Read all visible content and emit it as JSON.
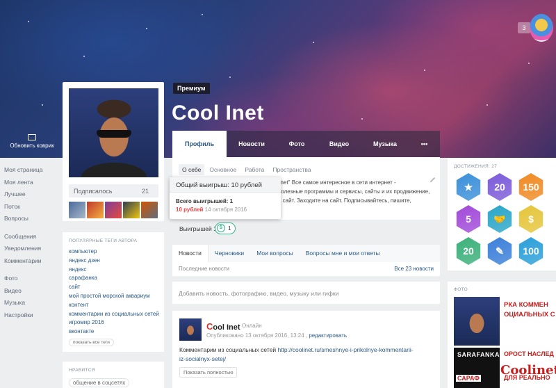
{
  "cover": {
    "update_label": "Обновить коврик",
    "badge_count": "3"
  },
  "left_nav": {
    "group1": [
      "Моя страница",
      "Моя лента",
      "Лучшее",
      "Поток",
      "Вопросы"
    ],
    "group2": [
      "Сообщения",
      "Уведомления",
      "Комментарии"
    ],
    "group3": [
      "Фото",
      "Видео",
      "Музыка",
      "Настройки"
    ]
  },
  "profile": {
    "premium_label": "Премиум",
    "username": "Cool Inet",
    "subscribed_label": "Подписалось",
    "subscribed_count": "21"
  },
  "tabs": [
    "Профиль",
    "Новости",
    "Фото",
    "Видео",
    "Музыка",
    "•••"
  ],
  "about": {
    "subtabs": [
      "О себе",
      "Основное",
      "Работа",
      "Пространства"
    ],
    "text_line1": "linet\" Все самое интересное в сети интернет -",
    "text_line2": "полезные программы и сервисы, сайты и их продвижение,",
    "text_line3": "а сайт. Заходите на сайт. Подписывайтесь, пишите,"
  },
  "wins": {
    "label": "Выигрышей 1:",
    "coin_symbol": "$",
    "count": "1"
  },
  "tooltip": {
    "title": "Общий выигрыш: 10 рублей",
    "total": "Всего выигрышей: 1",
    "amount": "10 рублей",
    "date": "14 октября 2016"
  },
  "news": {
    "tabs": [
      "Новости",
      "Черновики",
      "Мои вопросы",
      "Вопросы мне и мои ответы"
    ],
    "subtitle": "Последние новости",
    "all_link": "Все 23 новости"
  },
  "composer": {
    "placeholder": "Добавить новость, фотографию, видео, музыку или гифки"
  },
  "post": {
    "name_first": "C",
    "name_rest": "ool Inet",
    "status": "Онлайн",
    "meta": "Опубликовано 13 октября 2016, 13:24 ,",
    "edit_link": "редактировать",
    "text": "Комментарии из социальных сетей",
    "url_line1": "http://coolinet.ru/smeshnye-i-prikolnye-kommentarii-",
    "url_line2": "iz-socialnyx-setej/",
    "expand_label": "Показать полностью"
  },
  "tags": {
    "title": "Популярные теги автора",
    "items": [
      "компьютер",
      "яндекс дзен",
      "яндекс",
      "сарафанка",
      "сайт",
      "мой простой морской аквариум",
      "контент",
      "комментарии из социальных сетей",
      "игромир 2016",
      "вконтакте"
    ],
    "show_all": "показать все теги"
  },
  "likes": {
    "title": "Нравится",
    "item": "общение в соцсетях"
  },
  "achievements": {
    "title": "Достижения: 27",
    "badges": [
      {
        "label": "★",
        "color": "#3b8fd9"
      },
      {
        "label": "20",
        "color": "#7c5ad9"
      },
      {
        "label": "150",
        "color": "#f08a24"
      },
      {
        "label": "5",
        "color": "#a14ad9"
      },
      {
        "label": "🤝",
        "color": "#2aa6c9"
      },
      {
        "label": "$",
        "color": "#e5c53a"
      },
      {
        "label": "20",
        "color": "#3bb07a"
      },
      {
        "label": "✎",
        "color": "#3b7fd9"
      },
      {
        "label": "100",
        "color": "#2a9fd9"
      }
    ]
  },
  "photos": {
    "title": "Фото",
    "ph2_line1": "РКА КОММЕН",
    "ph2_line2": "ОЦИАЛЬНЫХ С",
    "ph3_text": "SARAFANKA",
    "ph3_text2": "САРАФ",
    "ph4_line1": "ОРОСТ НАСЛЕД",
    "ph4_line2": "ДЛЯ РЕАЛЬНО",
    "watermark": "Coolinet"
  }
}
